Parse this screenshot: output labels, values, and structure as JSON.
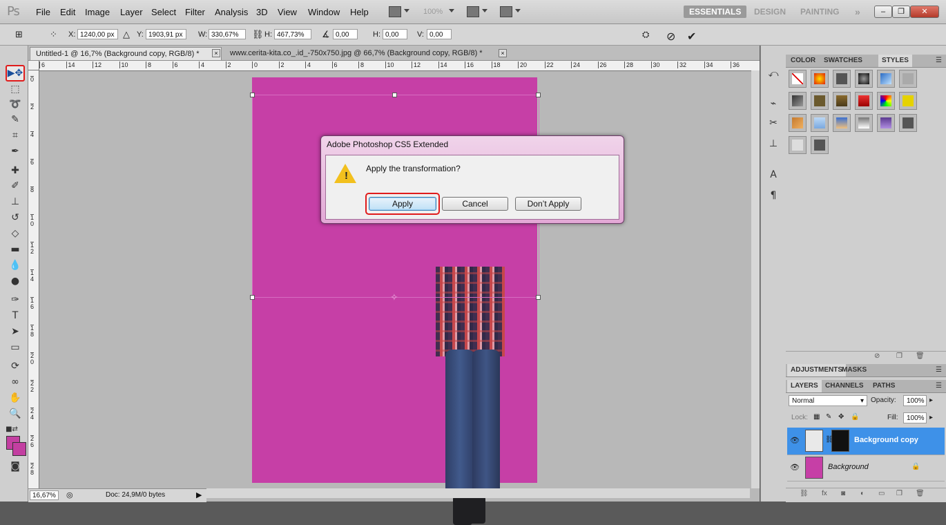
{
  "app": {
    "logo": "Ps"
  },
  "menu": [
    "File",
    "Edit",
    "Image",
    "Layer",
    "Select",
    "Filter",
    "Analysis",
    "3D",
    "View",
    "Window",
    "Help"
  ],
  "zoom_display": "100%",
  "workspaces": [
    "ESSENTIALS",
    "DESIGN",
    "PAINTING"
  ],
  "options": {
    "x_label": "X:",
    "x_value": "1240,00 px",
    "y_label": "Y:",
    "y_value": "1903,91 px",
    "w_label": "W:",
    "w_value": "330,67%",
    "h_label": "H:",
    "h_value": "467,73%",
    "rot_value": "0,00",
    "hskew_label": "H:",
    "hskew_value": "0,00",
    "vskew_label": "V:",
    "vskew_value": "0,00"
  },
  "tabs": [
    {
      "label": "Untitled-1 @ 16,7% (Background copy, RGB/8) *"
    },
    {
      "label": "www.cerita-kita.co_.id_-750x750.jpg @ 66,7% (Background copy, RGB/8) *"
    }
  ],
  "ruler_h": [
    "6",
    "14",
    "12",
    "10",
    "8",
    "6",
    "4",
    "2",
    "0",
    "2",
    "4",
    "6",
    "8",
    "10",
    "12",
    "14",
    "16",
    "18",
    "20",
    "22",
    "24",
    "26",
    "28",
    "30",
    "32",
    "34",
    "36"
  ],
  "ruler_v": [
    "0",
    "2",
    "4",
    "6",
    "8",
    "1\n0",
    "1\n2",
    "1\n4",
    "1\n6",
    "1\n8",
    "2\n0",
    "2\n2",
    "2\n4",
    "2\n6",
    "2\n8"
  ],
  "status": {
    "zoom": "16,67%",
    "doc": "Doc: 24,9M/0 bytes"
  },
  "dialog": {
    "title": "Adobe Photoshop CS5 Extended",
    "message": "Apply the transformation?",
    "apply": "Apply",
    "cancel": "Cancel",
    "dont_apply": "Don’t Apply"
  },
  "styles_panel": {
    "tabs": [
      "COLOR",
      "SWATCHES",
      "STYLES"
    ]
  },
  "adjust_panel": {
    "tabs": [
      "ADJUSTMENTS",
      "MASKS"
    ]
  },
  "layers_panel": {
    "tabs": [
      "LAYERS",
      "CHANNELS",
      "PATHS"
    ],
    "blend_mode": "Normal",
    "opacity_label": "Opacity:",
    "opacity": "100%",
    "lock_label": "Lock:",
    "fill_label": "Fill:",
    "fill": "100%",
    "layers": [
      {
        "name": "Background copy"
      },
      {
        "name": "Background"
      }
    ]
  },
  "colors": {
    "foreground": "#c33fa1",
    "background": "#c33fa1",
    "canvas": "#c63fa6",
    "selected_layer": "#3e91e8"
  }
}
